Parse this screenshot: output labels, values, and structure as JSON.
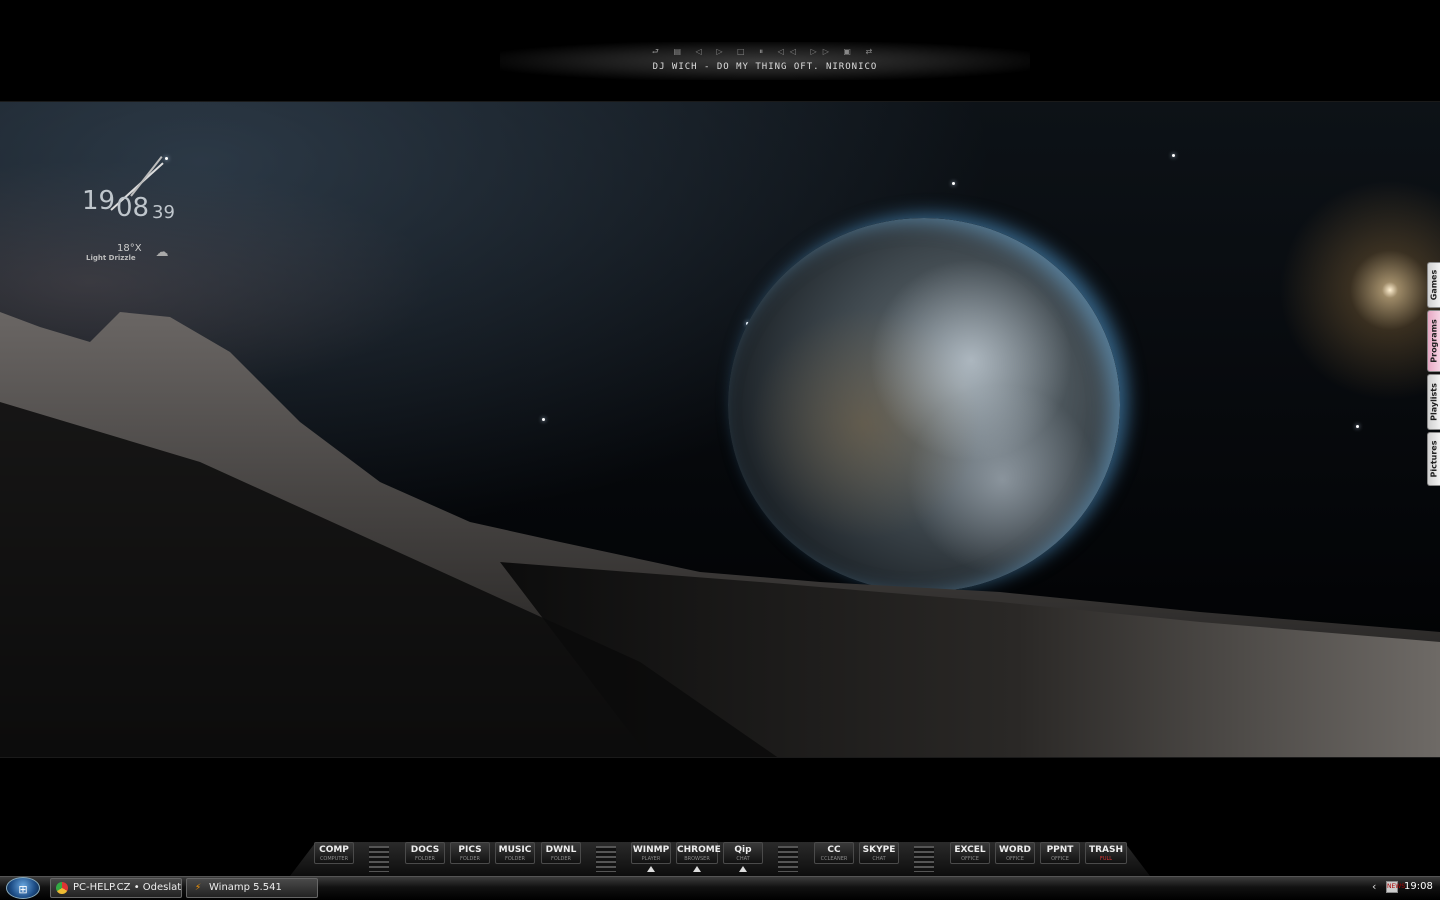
{
  "player": {
    "controls": [
      "⮐",
      "▤",
      "◁",
      "▷",
      "□",
      "⏸",
      "◁◁",
      "▷▷",
      "▣",
      "⇄"
    ],
    "track": "DJ Wich - Do My Thing Oft. Nironico"
  },
  "clock": {
    "hours": "19",
    "minutes": "08",
    "seconds": "39"
  },
  "weather": {
    "temp": "18°X",
    "desc": "Light Drizzle",
    "icon": "cloud-rain-icon"
  },
  "side_tabs": [
    {
      "label": "Games",
      "active": false
    },
    {
      "label": "Programs",
      "active": true
    },
    {
      "label": "Playlists",
      "active": false
    },
    {
      "label": "Pictures",
      "active": false
    }
  ],
  "dock": {
    "buttons": [
      {
        "label": "COMP",
        "sub": "COMPUTER"
      },
      {
        "label": "DOCS",
        "sub": "FOLDER"
      },
      {
        "label": "PICS",
        "sub": "FOLDER"
      },
      {
        "label": "MUSIC",
        "sub": "FOLDER"
      },
      {
        "label": "DWNL",
        "sub": "FOLDER"
      },
      {
        "label": "WINMP",
        "sub": "PLAYER"
      },
      {
        "label": "CHROME",
        "sub": "BROWSER"
      },
      {
        "label": "Qip",
        "sub": "CHAT"
      },
      {
        "label": "CC",
        "sub": "CCLEANER"
      },
      {
        "label": "SKYPE",
        "sub": "CHAT"
      },
      {
        "label": "EXCEL",
        "sub": "OFFICE"
      },
      {
        "label": "WORD",
        "sub": "OFFICE"
      },
      {
        "label": "PPNT",
        "sub": "OFFICE"
      },
      {
        "label": "TRASH",
        "sub": "FULL"
      }
    ]
  },
  "taskbar": {
    "start": "⊞",
    "tasks": [
      {
        "label": "PC-HELP.CZ • Odeslat...",
        "icon": "chrome-icon"
      },
      {
        "label": "Winamp 5.541",
        "icon": "winamp-icon"
      }
    ],
    "tray_arrow": "‹",
    "tray_icon": "NEWS",
    "time": "19:08"
  }
}
